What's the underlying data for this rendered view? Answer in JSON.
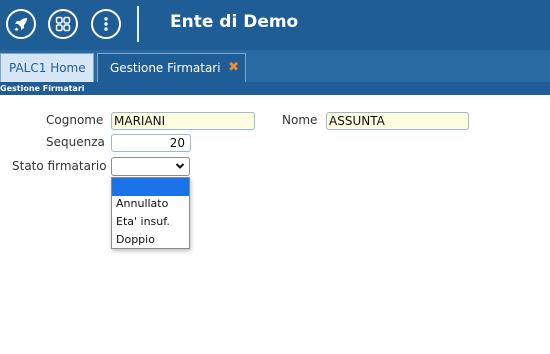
{
  "header": {
    "title": "Ente di Demo",
    "buttons": [
      {
        "icon": "rocket-icon"
      },
      {
        "icon": "grid-icon"
      },
      {
        "icon": "more-vertical-icon"
      }
    ]
  },
  "tabs": [
    {
      "label": "PALC1 Home",
      "active": false
    },
    {
      "label": "Gestione Firmatari",
      "active": true,
      "close": "✖"
    }
  ],
  "subheader": {
    "title": "Gestione Firmatari"
  },
  "form": {
    "cognome": {
      "label": "Cognome",
      "value": "MARIANI"
    },
    "nome": {
      "label": "Nome",
      "value": "ASSUNTA"
    },
    "sequenza": {
      "label": "Sequenza",
      "value": "20"
    },
    "stato": {
      "label": "Stato firmatario",
      "value": "",
      "options": [
        "",
        "Annullato",
        "Eta' insuf.",
        "Doppio"
      ]
    }
  },
  "colors": {
    "header_bg": "#1f5d96",
    "tab_close": "#f28a30",
    "field_yellow": "#fdfde0",
    "option_selected": "#1a73e8"
  }
}
